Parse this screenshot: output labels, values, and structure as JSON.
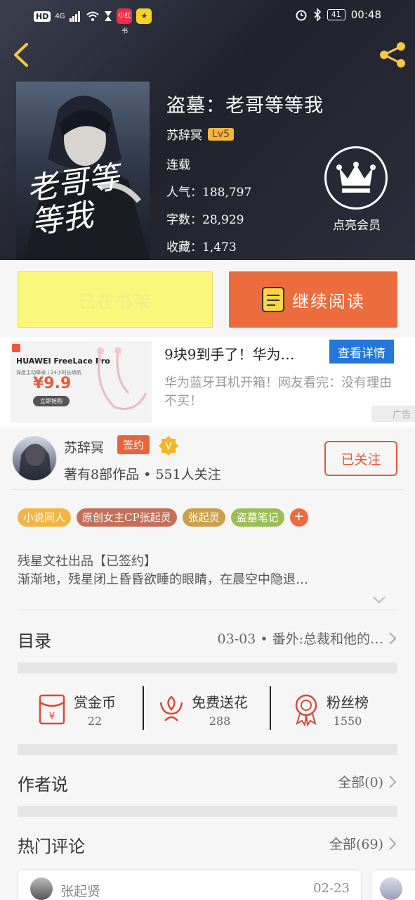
{
  "status_bar": {
    "hd": "HD",
    "network": "4G",
    "app1": "小红书",
    "app2": "★",
    "battery": "41",
    "time": "00:48"
  },
  "book": {
    "cover_text": "老哥等等我",
    "title": "盗墓：老哥等等我",
    "author": "苏辞冥",
    "level": "Lv5",
    "status": "连载",
    "popularity_label": "人气：",
    "popularity": "188,797",
    "words_label": "字数：",
    "words": "28,929",
    "collect_label": "收藏：",
    "collect": "1,473",
    "vip_label": "点亮会员"
  },
  "actions": {
    "shelf_label": "已在书架",
    "read_label": "继续阅读"
  },
  "ad": {
    "brand": "HUAWEI FreeLace Pro",
    "sub": "深度主动降噪 | 24小时长续航",
    "price": "¥9.9",
    "grab": "立即抢购",
    "title": "9块9到手了！华为…",
    "cta": "查看详情",
    "desc": "华为蓝牙耳机开箱！网友看完：没有理由不买！",
    "tag": "广告"
  },
  "author_card": {
    "name": "苏辞冥",
    "sign_badge": "签约",
    "v_badge": "V",
    "meta": "著有8部作品 • 551人关注",
    "follow_label": "已关注"
  },
  "tags": [
    {
      "label": "小说同人",
      "color": "#f2b544"
    },
    {
      "label": "原创女主CP张起灵",
      "color": "#c3705a"
    },
    {
      "label": "张起灵",
      "color": "#c9a04e"
    },
    {
      "label": "盗墓笔记",
      "color": "#9bbd55"
    }
  ],
  "tag_plus": "+",
  "summary": {
    "line1": "残星文社出品【已签约】",
    "line2": "渐渐地，残星闭上昏昏欲睡的眼睛，在晨空中隐退…"
  },
  "toc": {
    "title": "目录",
    "latest": "03-03 • 番外:总裁和他的…"
  },
  "stats": [
    {
      "label": "赏金币",
      "value": "22"
    },
    {
      "label": "免费送花",
      "value": "288"
    },
    {
      "label": "粉丝榜",
      "value": "1550"
    }
  ],
  "author_says": {
    "title": "作者说",
    "right": "全部(0)"
  },
  "hot_comments": {
    "title": "热门评论",
    "right": "全部(69)",
    "first_name": "张起贤",
    "first_date": "02-23"
  }
}
